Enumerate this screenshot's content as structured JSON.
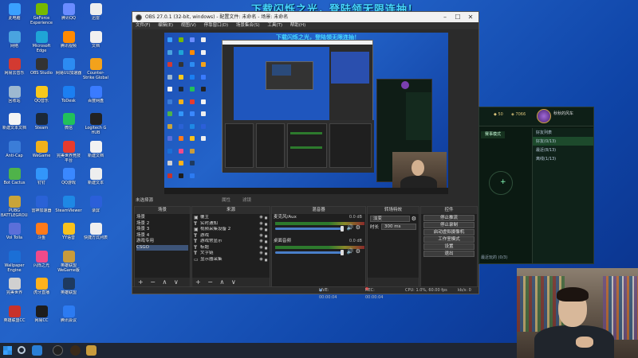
{
  "banner": "下载闪烁之光，登陆领无限连抽！",
  "desktop_icons": [
    {
      "label": "此电脑",
      "color": "#3aa0ff",
      "col": 0,
      "row": 0
    },
    {
      "label": "GeForce Experience",
      "color": "#76b900",
      "col": 1,
      "row": 0
    },
    {
      "label": "腾讯QQ",
      "color": "#6a8cff",
      "col": 2,
      "row": 0
    },
    {
      "label": "迅雷",
      "color": "#eeeeee",
      "col": 3,
      "row": 0
    },
    {
      "label": "网络",
      "color": "#4aa3df",
      "col": 0,
      "row": 1
    },
    {
      "label": "Microsoft Edge",
      "color": "#1fa4d6",
      "col": 1,
      "row": 1
    },
    {
      "label": "腾讯视频",
      "color": "#ff8a00",
      "col": 2,
      "row": 1
    },
    {
      "label": "文档",
      "color": "#f0f0f0",
      "col": 3,
      "row": 1
    },
    {
      "label": "网易云音乐",
      "color": "#d33a31",
      "col": 0,
      "row": 2
    },
    {
      "label": "OBS Studio",
      "color": "#333333",
      "col": 1,
      "row": 2
    },
    {
      "label": "网易UU加速器",
      "color": "#2c8cf2",
      "col": 2,
      "row": 2
    },
    {
      "label": "Counter-Strike Global",
      "color": "#f3a21b",
      "col": 3,
      "row": 2
    },
    {
      "label": "回收站",
      "color": "#9db8d0",
      "col": 0,
      "row": 3
    },
    {
      "label": "QQ音乐",
      "color": "#f8c81c",
      "col": 1,
      "row": 3
    },
    {
      "label": "ToDesk",
      "color": "#1b7ff2",
      "col": 2,
      "row": 3
    },
    {
      "label": "百度网盘",
      "color": "#3a7bff",
      "col": 3,
      "row": 3
    },
    {
      "label": "新建文本文档",
      "color": "#f4f4f4",
      "col": 0,
      "row": 4
    },
    {
      "label": "Steam",
      "color": "#1b2838",
      "col": 1,
      "row": 4
    },
    {
      "label": "微信",
      "color": "#21c15a",
      "col": 2,
      "row": 4
    },
    {
      "label": "Logitech G HUB",
      "color": "#222222",
      "col": 3,
      "row": 4
    },
    {
      "label": "Anti-Cap",
      "color": "#3b7dd8",
      "col": 0,
      "row": 5
    },
    {
      "label": "WeGame",
      "color": "#f1b11b",
      "col": 1,
      "row": 5
    },
    {
      "label": "完美世界竞技平台",
      "color": "#e63b2e",
      "col": 2,
      "row": 5
    },
    {
      "label": "新建文档",
      "color": "#f2f2f2",
      "col": 3,
      "row": 5
    },
    {
      "label": "Bot Cactus",
      "color": "#4fb34a",
      "col": 0,
      "row": 6
    },
    {
      "label": "钉钉",
      "color": "#3296fa",
      "col": 1,
      "row": 6
    },
    {
      "label": "QQ游戏",
      "color": "#3a88ff",
      "col": 2,
      "row": 6
    },
    {
      "label": "新建文本",
      "color": "#eeeeee",
      "col": 3,
      "row": 6
    },
    {
      "label": "PUBG BATTLEGROUNDS",
      "color": "#c9a43a",
      "col": 0,
      "row": 7
    },
    {
      "label": "雷神加速器",
      "color": "#2a62d6",
      "col": 1,
      "row": 7
    },
    {
      "label": "SteamViewer",
      "color": "#1e88e5",
      "col": 2,
      "row": 7
    },
    {
      "label": "录屏",
      "color": "#2b5fd9",
      "col": 3,
      "row": 7
    },
    {
      "label": "Vol Tolla",
      "color": "#5b6fd9",
      "col": 0,
      "row": 8
    },
    {
      "label": "斗鱼",
      "color": "#ff7a1a",
      "col": 1,
      "row": 8
    },
    {
      "label": "YY语音",
      "color": "#f9c21c",
      "col": 2,
      "row": 8
    },
    {
      "label": "快捷方式列表",
      "color": "#eeeeee",
      "col": 3,
      "row": 8
    },
    {
      "label": "Wallpaper Engine",
      "color": "#1b6fd6",
      "col": 0,
      "row": 9
    },
    {
      "label": "闪烁之光",
      "color": "#f04a8a",
      "col": 1,
      "row": 9
    },
    {
      "label": "英雄联盟WeGame版",
      "color": "#c89b3c",
      "col": 2,
      "row": 9
    },
    {
      "label": "完美世界",
      "color": "#d0d0d0",
      "col": 0,
      "row": 10
    },
    {
      "label": "虎牙直播",
      "color": "#ffb21c",
      "col": 1,
      "row": 10
    },
    {
      "label": "英雄联盟",
      "color": "#1e3a5f",
      "col": 2,
      "row": 10
    },
    {
      "label": "英雄联盟CC",
      "color": "#c8322a",
      "col": 0,
      "row": 11
    },
    {
      "label": "网易CC",
      "color": "#1d1d1d",
      "col": 1,
      "row": 11
    },
    {
      "label": "腾讯会议",
      "color": "#2c7bf2",
      "col": 2,
      "row": 11
    }
  ],
  "obs": {
    "title": "OBS 27.0.1 (32-bit, windows) - 配置文件: 未命名 - 场景: 未命名",
    "menu": [
      "文件(F)",
      "编辑(E)",
      "视图(V)",
      "停靠窗口(D)",
      "场景集合(S)",
      "工具(T)",
      "帮助(H)"
    ],
    "scenes_bar": {
      "left": "未选择源",
      "mid": "属性",
      "mid2": "滤镜"
    },
    "docks": {
      "scenes": {
        "title": "场景",
        "items": [
          "场景",
          "场景 2",
          "场景 3",
          "场景 4",
          "游戏专用",
          "CSGO"
        ],
        "active": 5
      },
      "sources": {
        "title": "来源",
        "items": [
          {
            "icon": "▣",
            "name": "覆主"
          },
          {
            "icon": "T",
            "name": "实时通知"
          },
          {
            "icon": "▣",
            "name": "视频采集设备 2"
          },
          {
            "icon": "T",
            "name": "游戏"
          },
          {
            "icon": "T",
            "name": "游戏常显示"
          },
          {
            "icon": "T",
            "name": "标题"
          },
          {
            "icon": "T",
            "name": "文字链"
          },
          {
            "icon": "▭",
            "name": "显示器采集"
          }
        ]
      },
      "mixer": {
        "title": "混音器",
        "channels": [
          {
            "name": "麦克风/Aux",
            "db": "0.0 dB"
          },
          {
            "name": "桌面音频",
            "db": "0.0 dB"
          }
        ]
      },
      "transitions": {
        "title": "转场特效",
        "type": "淡变",
        "duration_label": "时长",
        "duration": "300 ms"
      },
      "controls": {
        "title": "控件",
        "buttons": [
          "停止推流",
          "停止录制",
          "启动虚拟摄像机",
          "工作室模式",
          "设置",
          "退出"
        ]
      }
    },
    "dock_footer": "+ − ∧ ∨",
    "status": {
      "live": "LIVE: 00:00:04",
      "rec": "REC: 00:00:04",
      "cpu": "CPU: 1.0%, 60.00 fps",
      "kbs": "kb/s: 0"
    }
  },
  "game": {
    "player_name": "秋秋的风车",
    "currency1": "50",
    "currency2": "7066",
    "mode_button": "赛事模式",
    "side_rows": [
      "好友列表",
      "好友(0/13)",
      "最近(8/13)",
      "离线(1/13)"
    ],
    "footer": "最近玩的 (0/3)"
  },
  "icons": {
    "window": [
      "minimize-icon",
      "maximize-icon",
      "close-icon"
    ],
    "source_visibility": "eye-icon",
    "source_lock": "lock-icon"
  }
}
